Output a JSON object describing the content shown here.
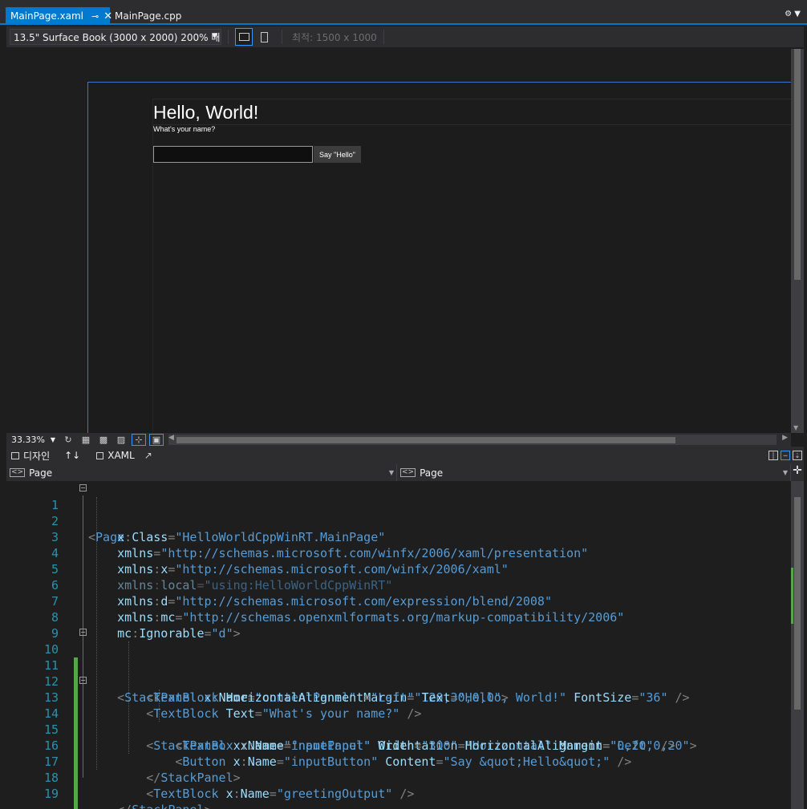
{
  "tabs": [
    {
      "label": "MainPage.xaml",
      "active": true,
      "pin_icon": "pin-icon",
      "close_icon": "close-icon"
    },
    {
      "label": "MainPage.cpp",
      "active": false
    }
  ],
  "designer": {
    "device": "13.5\" Surface Book (3000 x 2000) 200% 배율",
    "fit_label": "최적: 1500 x 1000",
    "zoom": "33.33%",
    "preview": {
      "title": "Hello, World!",
      "question": "What's your name?",
      "button": "Say \"Hello\""
    }
  },
  "split": {
    "design_tab": "디자인",
    "swap_icon": "↑↓",
    "xaml_tab": "XAML"
  },
  "nav": {
    "left": "Page",
    "right": "Page"
  },
  "code": {
    "lines": [
      "1",
      "2",
      "3",
      "4",
      "5",
      "6",
      "7",
      "8",
      "9",
      "10",
      "11",
      "12",
      "13",
      "14",
      "15",
      "16",
      "17",
      "18",
      "19"
    ]
  },
  "colors": {
    "accent": "#007acc",
    "tag": "#569cd6",
    "attribute": "#9cdcfe",
    "bracket": "#808080",
    "change_marker": "#57a64a",
    "line_number": "#2b91af"
  }
}
